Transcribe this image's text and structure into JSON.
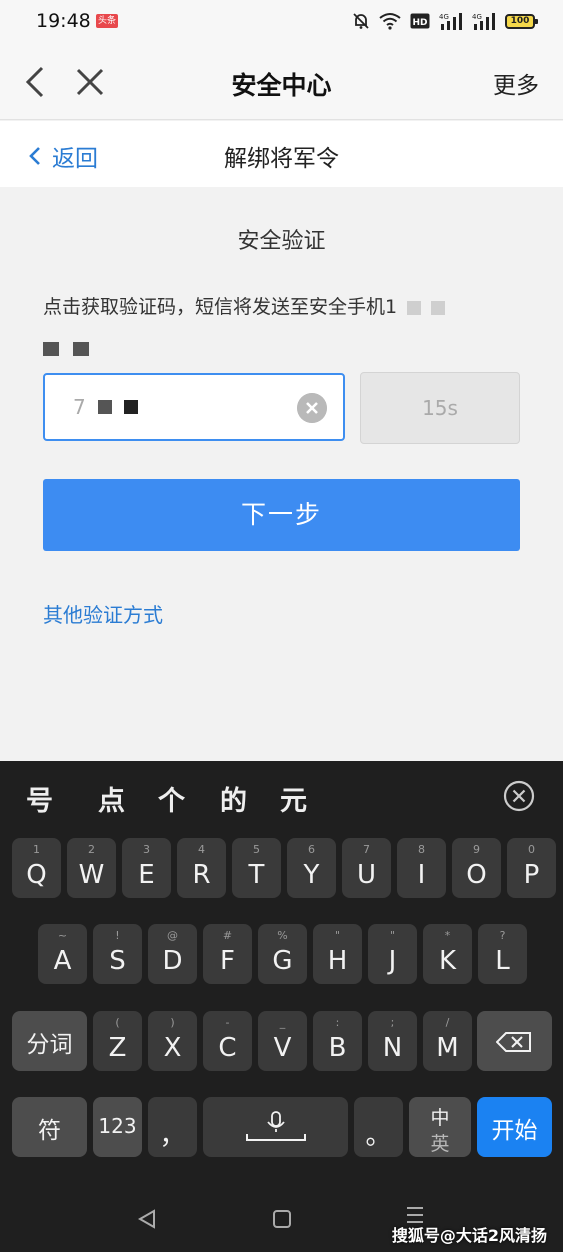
{
  "status_bar": {
    "time": "19:48",
    "badge": "头条",
    "battery": "100"
  },
  "title_bar": {
    "title": "安全中心",
    "more": "更多"
  },
  "sub_header": {
    "back_label": "返回",
    "title": "解绑将军令"
  },
  "verify": {
    "section_title": "安全验证",
    "sms_text": "点击获取验证码，短信将发送至安全手机1",
    "code_prefix": "7",
    "countdown": "15s",
    "next_button": "下一步",
    "other_method": "其他验证方式"
  },
  "keyboard": {
    "candidates": [
      "号",
      "点",
      "个",
      "的",
      "元"
    ],
    "row1": [
      {
        "sub": "1",
        "key": "Q"
      },
      {
        "sub": "2",
        "key": "W"
      },
      {
        "sub": "3",
        "key": "E"
      },
      {
        "sub": "4",
        "key": "R"
      },
      {
        "sub": "5",
        "key": "T"
      },
      {
        "sub": "6",
        "key": "Y"
      },
      {
        "sub": "7",
        "key": "U"
      },
      {
        "sub": "8",
        "key": "I"
      },
      {
        "sub": "9",
        "key": "O"
      },
      {
        "sub": "0",
        "key": "P"
      }
    ],
    "row2": [
      {
        "sub": "~",
        "key": "A"
      },
      {
        "sub": "!",
        "key": "S"
      },
      {
        "sub": "@",
        "key": "D"
      },
      {
        "sub": "#",
        "key": "F"
      },
      {
        "sub": "%",
        "key": "G"
      },
      {
        "sub": "\"",
        "key": "H"
      },
      {
        "sub": "\"",
        "key": "J"
      },
      {
        "sub": "*",
        "key": "K"
      },
      {
        "sub": "?",
        "key": "L"
      }
    ],
    "row3": [
      {
        "sub": "(",
        "key": "Z"
      },
      {
        "sub": ")",
        "key": "X"
      },
      {
        "sub": "-",
        "key": "C"
      },
      {
        "sub": "_",
        "key": "V"
      },
      {
        "sub": ":",
        "key": "B"
      },
      {
        "sub": ";",
        "key": "N"
      },
      {
        "sub": "/",
        "key": "M"
      }
    ],
    "segment_key": "分词",
    "symbol_key": "符",
    "number_key": "123",
    "comma_key": "，",
    "period_key": "。",
    "lang_top": "中",
    "lang_bottom": "英",
    "enter_key": "开始"
  },
  "watermark": "搜狐号@大话2风清扬"
}
